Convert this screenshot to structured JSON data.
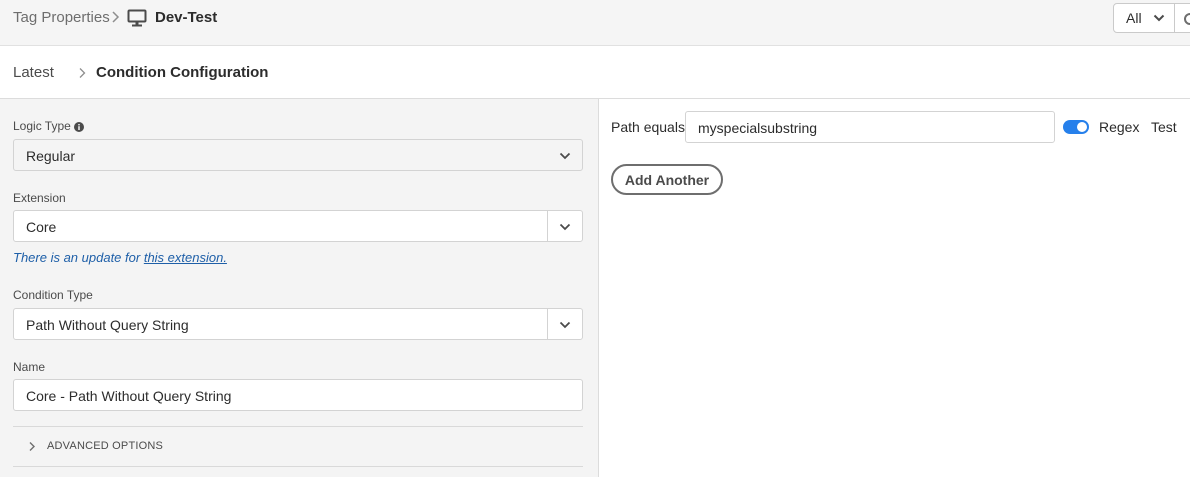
{
  "header": {
    "breadcrumb_root": "Tag Properties",
    "property_name": "Dev-Test",
    "property_icon": "monitor-icon",
    "filter": {
      "label": "All"
    }
  },
  "subheader": {
    "back_label": "Latest",
    "title": "Condition Configuration"
  },
  "form": {
    "logic_type": {
      "label": "Logic Type",
      "value": "Regular",
      "info_icon": "info-icon"
    },
    "extension": {
      "label": "Extension",
      "value": "Core",
      "update_note_prefix": "There is an update for",
      "update_link": "this extension."
    },
    "condition_type": {
      "label": "Condition Type",
      "value": "Path Without Query String"
    },
    "name": {
      "label": "Name",
      "value": "Core - Path Without Query String"
    },
    "advanced_options": "ADVANCED OPTIONS"
  },
  "condition": {
    "path_label": "Path equals",
    "path_value": "myspecialsubstring",
    "regex_enabled": true,
    "regex_label": "Regex",
    "test_label": "Test",
    "add_another_label": "Add Another"
  },
  "colors": {
    "accent": "#2680eb",
    "link": "#1e5fa8"
  }
}
